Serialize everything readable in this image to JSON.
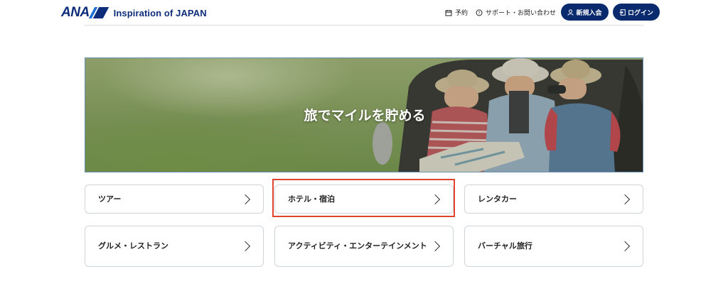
{
  "header": {
    "logo_text": "ANA",
    "tagline": "Inspiration of JAPAN",
    "nav": {
      "reserve": "予約",
      "support": "サポート・お問い合わせ"
    },
    "buttons": {
      "join": "新規入会",
      "login": "ログイン"
    },
    "brand_color": "#0a2a6e"
  },
  "hero": {
    "title": "旅でマイルを貯める"
  },
  "categories": [
    {
      "label": "ツアー"
    },
    {
      "label": "ホテル・宿泊"
    },
    {
      "label": "レンタカー"
    },
    {
      "label": "グルメ・レストラン"
    },
    {
      "label": "アクティビティ・エンターテインメント"
    },
    {
      "label": "バーチャル旅行"
    }
  ],
  "highlight_color": "#e0442f"
}
